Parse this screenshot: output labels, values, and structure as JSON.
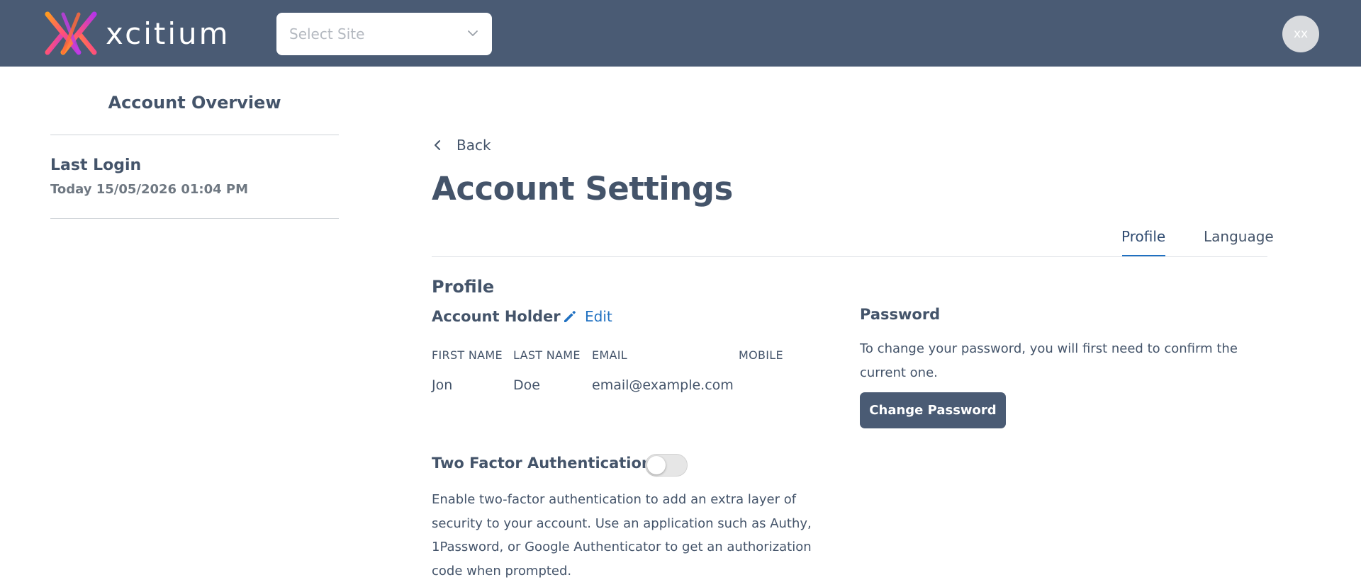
{
  "header": {
    "brand_name": "xcitium",
    "site_select": {
      "placeholder": "Select Site"
    },
    "avatar_initials": "xx"
  },
  "sidebar": {
    "title": "Account Overview",
    "last_login_label": "Last Login",
    "last_login_value": "Today 15/05/2026 01:04 PM"
  },
  "main": {
    "back_label": "Back",
    "page_title": "Account Settings",
    "tabs": [
      {
        "label": "Profile",
        "active": true
      },
      {
        "label": "Language",
        "active": false
      }
    ],
    "section_title": "Profile",
    "account_holder": {
      "title": "Account Holder",
      "edit_label": "Edit",
      "columns": [
        "FIRST NAME",
        "LAST NAME",
        "EMAIL",
        "MOBILE"
      ],
      "values": [
        "Jon",
        "Doe",
        "email@example.com",
        ""
      ]
    },
    "two_factor": {
      "title": "Two Factor Authentication",
      "enabled": false,
      "description": "Enable two-factor authentication to add an extra layer of security to your account. Use an application such as Authy, 1Password, or Google Authenticator to get an authorization code when prompted."
    },
    "password": {
      "title": "Password",
      "description": "To change your password, you will first need to confirm the current one.",
      "button_label": "Change Password"
    }
  },
  "colors": {
    "header_bg": "#4a5b74",
    "text_primary": "#44546a",
    "link_blue": "#1f70c1",
    "button_bg": "#4a5b74"
  },
  "icons": [
    "xcitium-logo-icon",
    "chevron-down-icon",
    "chevron-left-icon",
    "pencil-icon"
  ]
}
